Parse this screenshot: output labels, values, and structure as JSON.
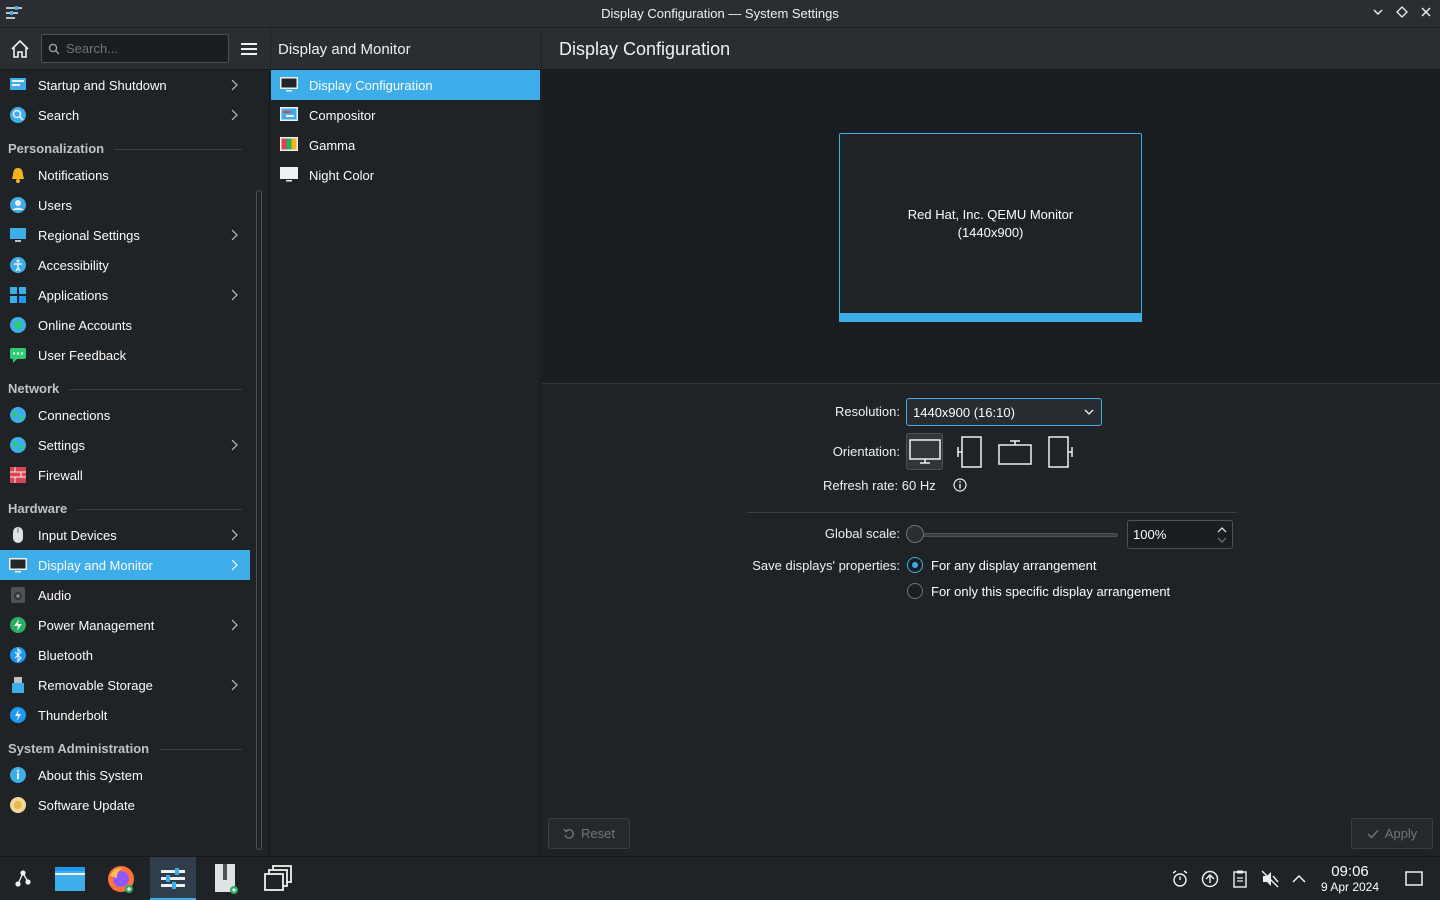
{
  "window": {
    "title": "Display Configuration — System Settings"
  },
  "sidebar": {
    "search_placeholder": "Search...",
    "items": [
      {
        "label": "Startup and Shutdown",
        "icon": "startup-icon",
        "chevron": true
      },
      {
        "label": "Search",
        "icon": "search-globe-icon",
        "chevron": true
      },
      {
        "section": "Personalization"
      },
      {
        "label": "Notifications",
        "icon": "bell-icon"
      },
      {
        "label": "Users",
        "icon": "users-icon"
      },
      {
        "label": "Regional Settings",
        "icon": "regional-icon",
        "chevron": true
      },
      {
        "label": "Accessibility",
        "icon": "accessibility-icon"
      },
      {
        "label": "Applications",
        "icon": "applications-icon",
        "chevron": true
      },
      {
        "label": "Online Accounts",
        "icon": "online-accounts-icon"
      },
      {
        "label": "User Feedback",
        "icon": "feedback-icon"
      },
      {
        "section": "Network"
      },
      {
        "label": "Connections",
        "icon": "globe-icon"
      },
      {
        "label": "Settings",
        "icon": "globe-settings-icon",
        "chevron": true
      },
      {
        "label": "Firewall",
        "icon": "firewall-icon"
      },
      {
        "section": "Hardware"
      },
      {
        "label": "Input Devices",
        "icon": "mouse-icon",
        "chevron": true
      },
      {
        "label": "Display and Monitor",
        "icon": "monitor-icon",
        "chevron": true,
        "active": true
      },
      {
        "label": "Audio",
        "icon": "speaker-icon"
      },
      {
        "label": "Power Management",
        "icon": "power-icon",
        "chevron": true
      },
      {
        "label": "Bluetooth",
        "icon": "bluetooth-icon"
      },
      {
        "label": "Removable Storage",
        "icon": "usb-icon",
        "chevron": true
      },
      {
        "label": "Thunderbolt",
        "icon": "thunderbolt-icon"
      },
      {
        "section": "System Administration"
      },
      {
        "label": "About this System",
        "icon": "info-icon"
      },
      {
        "label": "Software Update",
        "icon": "update-icon"
      }
    ]
  },
  "midcol": {
    "title": "Display and Monitor",
    "items": [
      {
        "label": "Display Configuration",
        "icon": "monitor-icon",
        "active": true
      },
      {
        "label": "Compositor",
        "icon": "compositor-icon"
      },
      {
        "label": "Gamma",
        "icon": "gamma-icon"
      },
      {
        "label": "Night Color",
        "icon": "night-color-icon"
      }
    ]
  },
  "main": {
    "title": "Display Configuration",
    "monitor_name": "Red Hat, Inc. QEMU Monitor",
    "monitor_res": "(1440x900)",
    "resolution_label": "Resolution:",
    "resolution_value": "1440x900 (16:10)",
    "orientation_label": "Orientation:",
    "refresh_text": "Refresh rate: 60 Hz",
    "scale_label": "Global scale:",
    "scale_value": "100%",
    "scale_fraction": 0.0,
    "save_label": "Save displays' properties:",
    "radio_any": "For any display arrangement",
    "radio_specific": "For only this specific display arrangement",
    "reset_label": "Reset",
    "apply_label": "Apply"
  },
  "taskbar": {
    "time": "09:06",
    "date": "9 Apr 2024"
  },
  "colors": {
    "accent": "#3daee9",
    "bg": "#202326",
    "header": "#2a2e32"
  }
}
